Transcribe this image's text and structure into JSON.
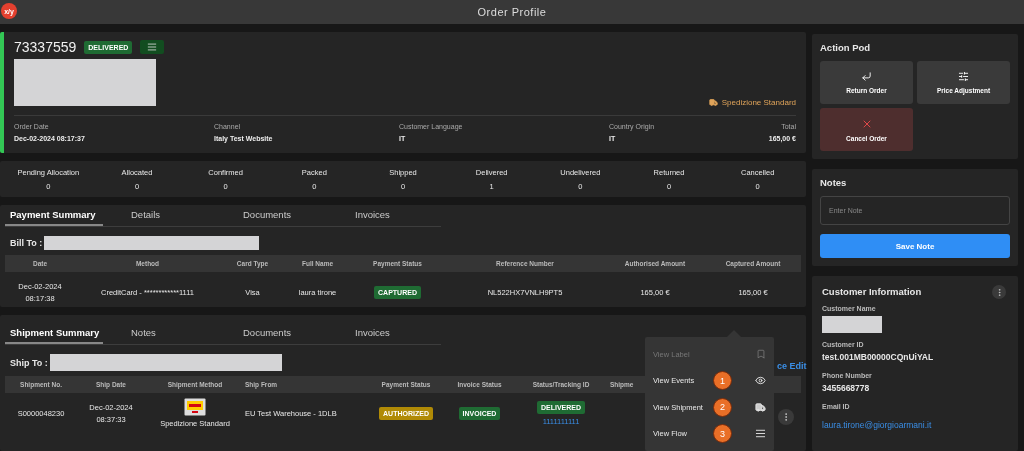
{
  "window": {
    "logo": "x/y",
    "title": "Order Profile"
  },
  "order": {
    "number": "73337559",
    "status": {
      "text": "DELIVERED",
      "color": "#1f6b33"
    },
    "shipping_method": "Spedizione Standard",
    "fields": [
      {
        "label": "Order Date",
        "value": "Dec-02-2024 08:17:37"
      },
      {
        "label": "Channel",
        "value": "Italy Test Website"
      },
      {
        "label": "Customer Language",
        "value": "IT"
      },
      {
        "label": "Country Origin",
        "value": "IT"
      },
      {
        "label": "Total",
        "value": "165,00 €"
      }
    ]
  },
  "status_counts": [
    {
      "label": "Pending Allocation",
      "count": "0"
    },
    {
      "label": "Allocated",
      "count": "0"
    },
    {
      "label": "Confirmed",
      "count": "0"
    },
    {
      "label": "Packed",
      "count": "0"
    },
    {
      "label": "Shipped",
      "count": "0"
    },
    {
      "label": "Delivered",
      "count": "1"
    },
    {
      "label": "Undelivered",
      "count": "0"
    },
    {
      "label": "Returned",
      "count": "0"
    },
    {
      "label": "Cancelled",
      "count": "0"
    }
  ],
  "payment": {
    "tabs": [
      {
        "label": "Payment Summary",
        "selected": true
      },
      {
        "label": "Details",
        "selected": false
      },
      {
        "label": "Documents",
        "selected": false
      },
      {
        "label": "Invoices",
        "selected": false
      }
    ],
    "bill_to": "Bill To :",
    "columns": [
      "Date",
      "Method",
      "Card Type",
      "Full Name",
      "Payment Status",
      "Reference Number",
      "Authorised Amount",
      "Captured Amount"
    ],
    "rows": [
      [
        {
          "kind": "lines",
          "lines": [
            "Dec-02-2024",
            "08:17:38"
          ]
        },
        {
          "kind": "text",
          "text": "CreditCard - ************1111"
        },
        {
          "kind": "text",
          "text": "Visa"
        },
        {
          "kind": "text",
          "text": "laura tirone"
        },
        {
          "kind": "badge",
          "text": "CAPTURED",
          "color": "#1f6b33"
        },
        {
          "kind": "text",
          "text": "NL522HX7VNLH9PT5"
        },
        {
          "kind": "text",
          "text": "165,00 €"
        },
        {
          "kind": "text",
          "text": "165,00 €"
        }
      ]
    ]
  },
  "shipment": {
    "tabs": [
      {
        "label": "Shipment Summary",
        "selected": true
      },
      {
        "label": "Notes",
        "selected": false
      },
      {
        "label": "Documents",
        "selected": false
      },
      {
        "label": "Invoices",
        "selected": false
      }
    ],
    "ship_to": "Ship To :",
    "edit_link": "ce Edit",
    "columns": [
      "Shipment No.",
      "Ship Date",
      "Shipment Method",
      "Ship From",
      "Payment Status",
      "Invoice Status",
      "Status/Tracking ID",
      "Shipme"
    ],
    "rows": [
      [
        {
          "kind": "text",
          "text": "S0000048230"
        },
        {
          "kind": "lines",
          "lines": [
            "Dec-02-2024",
            "08:37:33"
          ]
        },
        {
          "kind": "carrier",
          "text": "Spedizione Standard"
        },
        {
          "kind": "left",
          "text": "EU Test Warehouse - 1DLB"
        },
        {
          "kind": "badge",
          "text": "AUTHORIZED",
          "color": "#b08a06"
        },
        {
          "kind": "badge",
          "text": "INVOICED",
          "color": "#1f6b33"
        },
        {
          "kind": "tracking",
          "text": "DELIVERED",
          "color": "#1f6b33",
          "link": "1111111111"
        },
        {
          "kind": "empty"
        }
      ]
    ]
  },
  "action_pod": {
    "title": "Action Pod",
    "actions": [
      {
        "label": "Return Order",
        "kind": "return"
      },
      {
        "label": "Price Adjustment",
        "kind": "adjust"
      },
      {
        "label": "Cancel Order",
        "kind": "cancel"
      }
    ]
  },
  "notes": {
    "title": "Notes",
    "placeholder": "Enter Note",
    "button": "Save Note"
  },
  "customer": {
    "title": "Customer Information",
    "fields": [
      {
        "label": "Customer Name",
        "kind": "redacted"
      },
      {
        "label": "Customer ID",
        "kind": "text",
        "value": "test.001MB00000CQnUiYAL"
      },
      {
        "label": "Phone Number",
        "kind": "text",
        "value": "3455668778"
      },
      {
        "label": "Email ID",
        "kind": "link",
        "value": "laura.tirone@giorgioarmani.it"
      }
    ]
  },
  "row_menu": {
    "items": [
      {
        "label": "View Label",
        "disabled": true
      },
      {
        "label": "View Events",
        "number": "1",
        "disabled": false
      },
      {
        "label": "View Shipment",
        "number": "2",
        "disabled": false
      },
      {
        "label": "View Flow",
        "number": "3",
        "disabled": false
      }
    ]
  }
}
